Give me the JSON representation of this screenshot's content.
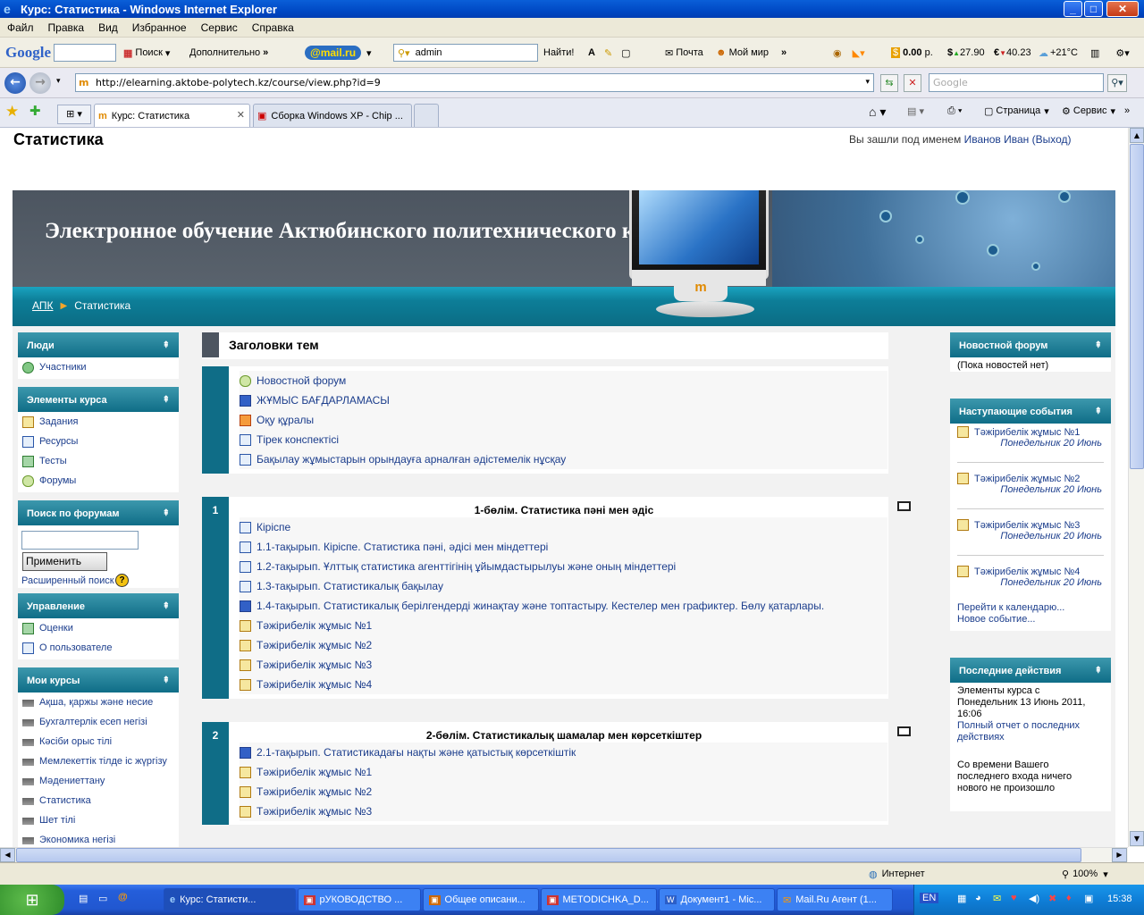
{
  "window": {
    "title": "Курс: Статистика - Windows Internet Explorer"
  },
  "menu": [
    "Файл",
    "Правка",
    "Вид",
    "Избранное",
    "Сервис",
    "Справка"
  ],
  "toolbar": {
    "google": "Google",
    "search": "Поиск",
    "more": "Дополнительно",
    "mailru": "@mail.ru",
    "user": "admin",
    "find": "Найти!",
    "mail": "Почта",
    "myworld": "Мой мир",
    "money": "0.00",
    "money_unit": "р.",
    "usd": "27.90",
    "eur": "40.23",
    "weather": "+21°C"
  },
  "address": {
    "url": "http://elearning.aktobe-polytech.kz/course/view.php?id=9",
    "search_placeholder": "Google"
  },
  "tabs": [
    {
      "label": "Курс: Статистика"
    },
    {
      "label": "Сборка Windows XP - Chip ..."
    }
  ],
  "cmdbar": {
    "page": "Страница",
    "service": "Сервис"
  },
  "page": {
    "course_title": "Статистика",
    "login_prefix": "Вы зашли под именем",
    "user_name": "Иванов Иван",
    "logout": "(Выход)",
    "banner": "Электронное обучение Актюбинского политехнического колледжа",
    "breadcrumb_root": "АПК",
    "breadcrumb_current": "Статистика",
    "topics_title": "Заголовки тем"
  },
  "left": {
    "people": {
      "title": "Люди",
      "items": [
        "Участники"
      ]
    },
    "activities": {
      "title": "Элементы курса",
      "items": [
        "Задания",
        "Ресурсы",
        "Тесты",
        "Форумы"
      ]
    },
    "search": {
      "title": "Поиск по форумам",
      "button": "Применить",
      "advanced": "Расширенный поиск"
    },
    "admin": {
      "title": "Управление",
      "items": [
        "Оценки",
        "О пользователе"
      ]
    },
    "mycourses": {
      "title": "Мои курсы",
      "items": [
        "Ақша, қаржы және несие",
        "Бухгалтерлік есеп негізі",
        "Кәсіби орыс тілі",
        "Мемлекеттік тілде іс жүргізу",
        "Мәдениеттану",
        "Статистика",
        "Шет тілі",
        "Экономика негізі"
      ]
    }
  },
  "sections": {
    "s0": [
      "Новостной форум",
      "ЖҰМЫС БАҒДАРЛАМАСЫ",
      "Оқу құралы",
      "Тірек конспектісі",
      "Бақылау жұмыстарын орындауға арналған әдістемелік нұсқау"
    ],
    "s1": {
      "num": "1",
      "title": "1-бөлім. Статистика пәні мен әдіс",
      "items": [
        "Кіріспе",
        "1.1-тақырып. Кіріспе. Статистика пәні, әдісі мен міндеттері",
        "1.2-тақырып. Ұлттық статистика агенттігінің ұйымдастырылуы және оның міндеттері",
        "1.3-тақырып. Статистикалық бақылау",
        "1.4-тақырып. Статистикалық берілгендерді жинақтау және топтастыру. Кестелер мен графиктер. Бөлу қатарлары.",
        "Тәжірибелік жұмыс №1",
        "Тәжірибелік жұмыс №2",
        "Тәжірибелік жұмыс №3",
        "Тәжірибелік жұмыс №4"
      ]
    },
    "s2": {
      "num": "2",
      "title": "2-бөлім. Статистикалық шамалар мен көрсеткіштер",
      "items": [
        "2.1-тақырып. Статистикадағы нақты және қатыстық көрсеткіштік",
        "Тәжірибелік жұмыс №1",
        "Тәжірибелік жұмыс №2",
        "Тәжірибелік жұмыс №3"
      ]
    }
  },
  "right": {
    "news": {
      "title": "Новостной форум",
      "empty": "(Пока новостей нет)"
    },
    "events": {
      "title": "Наступающие события",
      "items": [
        {
          "name": "Тәжірибелік жұмыс №1",
          "date": "Понедельник 20 Июнь"
        },
        {
          "name": "Тәжірибелік жұмыс №2",
          "date": "Понедельник 20 Июнь"
        },
        {
          "name": "Тәжірибелік жұмыс №3",
          "date": "Понедельник 20 Июнь"
        },
        {
          "name": "Тәжірибелік жұмыс №4",
          "date": "Понедельник 20 Июнь"
        }
      ],
      "goto": "Перейти к календарю...",
      "new": "Новое событие..."
    },
    "recent": {
      "title": "Последние действия",
      "since1": "Элементы курса с",
      "since2": "Понедельник 13 Июнь 2011,",
      "since3": "16:06",
      "full1": "Полный отчет о последних",
      "full2": "действиях",
      "none1": "Со времени Вашего",
      "none2": "последнего входа ничего",
      "none3": "нового не произошло"
    }
  },
  "status": {
    "zone": "Интернет",
    "zoom": "100%"
  },
  "taskbar": {
    "items": [
      "Курс: Статисти...",
      "рУКОВОДСТВО ...",
      "Общее описани...",
      "METODICHKA_D...",
      "Документ1 - Mic...",
      "Mail.Ru Агент (1..."
    ],
    "lang": "EN",
    "clock": "15:38"
  }
}
